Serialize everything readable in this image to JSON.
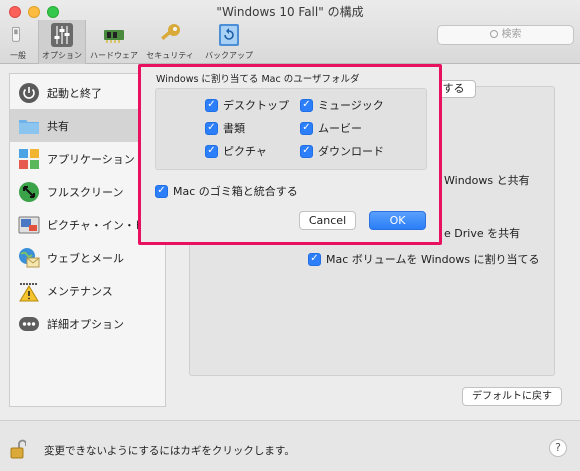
{
  "window": {
    "title": "\"Windows 10 Fall\" の構成"
  },
  "toolbar": {
    "items": [
      {
        "label": "一般",
        "icon": "switch-icon"
      },
      {
        "label": "オプション",
        "icon": "sliders-icon",
        "selected": true
      },
      {
        "label": "ハードウェア",
        "icon": "chip-icon"
      },
      {
        "label": "セキュリティ",
        "icon": "key-icon"
      },
      {
        "label": "バックアップ",
        "icon": "backup-icon"
      }
    ],
    "search_placeholder": "検索"
  },
  "sidebar": {
    "items": [
      {
        "label": "起動と終了",
        "icon": "power-icon"
      },
      {
        "label": "共有",
        "icon": "folder-icon",
        "selected": true
      },
      {
        "label": "アプリケーション",
        "icon": "apps-icon"
      },
      {
        "label": "フルスクリーン",
        "icon": "fullscreen-icon"
      },
      {
        "label": "ピクチャ・イン・ピクチ",
        "icon": "picture-in-picture-icon"
      },
      {
        "label": "ウェブとメール",
        "icon": "globe-mail-icon"
      },
      {
        "label": "メンテナンス",
        "icon": "maintenance-icon"
      },
      {
        "label": "詳細オプション",
        "icon": "more-icon"
      }
    ]
  },
  "background": {
    "button_fragment": "有する",
    "windows_share_fragment": "Windows と共有",
    "onedrive_fragment": "e Drive を共有",
    "mac_volumes_label": "Mac ボリュームを Windows に割り当てる",
    "defaults_button": "デフォルトに戻す"
  },
  "dialog": {
    "title": "Windows に割り当てる Mac のユーザフォルダ",
    "folders": [
      {
        "label": "デスクトップ",
        "checked": true
      },
      {
        "label": "ミュージック",
        "checked": true
      },
      {
        "label": "書類",
        "checked": true
      },
      {
        "label": "ムービー",
        "checked": true
      },
      {
        "label": "ピクチャ",
        "checked": true
      },
      {
        "label": "ダウンロード",
        "checked": true
      }
    ],
    "trash_label": "Mac のゴミ箱と統合する",
    "cancel_label": "Cancel",
    "ok_label": "OK"
  },
  "footer": {
    "lock_text": "変更できないようにするにはカギをクリックします。",
    "help_label": "?"
  },
  "colors": {
    "accent": "#2d7ff9",
    "highlight": "#e8115f"
  }
}
